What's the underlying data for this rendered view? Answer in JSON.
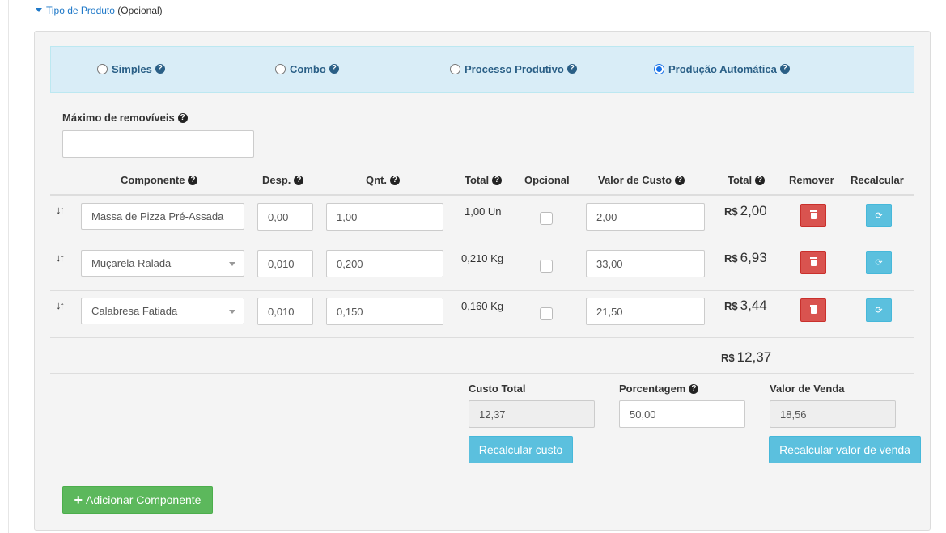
{
  "section": {
    "toggle_label": "Tipo de Produto",
    "optional_label": "(Opcional)"
  },
  "product_types": [
    {
      "label": "Simples",
      "selected": false
    },
    {
      "label": "Combo",
      "selected": false
    },
    {
      "label": "Processo Produtivo",
      "selected": false
    },
    {
      "label": "Produção Automática",
      "selected": true
    }
  ],
  "max_removable": {
    "label": "Máximo de removíveis",
    "value": ""
  },
  "table": {
    "headers": {
      "componente": "Componente",
      "desp": "Desp.",
      "qnt": "Qnt.",
      "total": "Total",
      "opcional": "Opcional",
      "valor_custo": "Valor de Custo",
      "total_money": "Total",
      "remover": "Remover",
      "recalcular": "Recalcular"
    },
    "rows": [
      {
        "componente": "Massa de Pizza Pré-Assada",
        "desp": "0,00",
        "qnt": "1,00",
        "total": "1,00 Un",
        "opcional": false,
        "valor_custo": "2,00",
        "currency": "R$",
        "total_money": "2,00"
      },
      {
        "componente": "Muçarela Ralada",
        "desp": "0,010",
        "qnt": "0,200",
        "total": "0,210 Kg",
        "opcional": false,
        "valor_custo": "33,00",
        "currency": "R$",
        "total_money": "6,93"
      },
      {
        "componente": "Calabresa Fatiada",
        "desp": "0,010",
        "qnt": "0,150",
        "total": "0,160 Kg",
        "opcional": false,
        "valor_custo": "21,50",
        "currency": "R$",
        "total_money": "3,44"
      }
    ],
    "grand_total": {
      "currency": "R$",
      "value": "12,37"
    }
  },
  "summary": {
    "custo_total": {
      "label": "Custo Total",
      "value": "12,37"
    },
    "porcentagem": {
      "label": "Porcentagem",
      "value": "50,00"
    },
    "valor_venda": {
      "label": "Valor de Venda",
      "value": "18,56"
    },
    "recalc_cost_label": "Recalcular custo",
    "recalc_sale_label": "Recalcular valor de venda"
  },
  "add_component_label": "Adicionar Componente",
  "colors": {
    "primary_link": "#1e78c8",
    "info": "#5bc0de",
    "danger": "#d9534f",
    "success": "#5cb85c",
    "band": "#d9edf7"
  }
}
